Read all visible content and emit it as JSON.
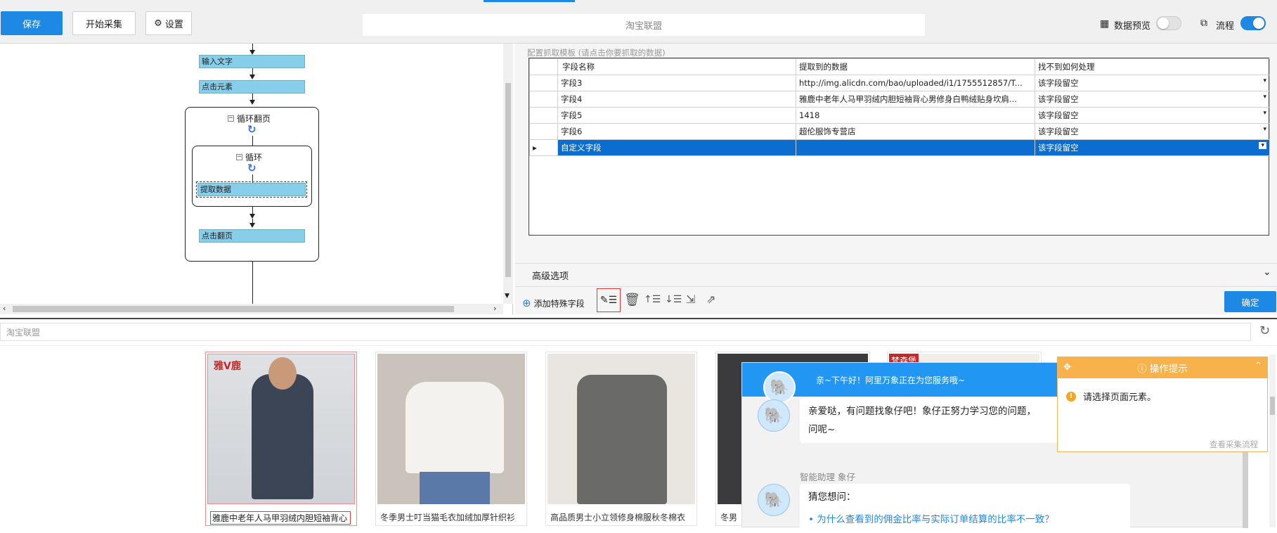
{
  "toolbar": {
    "save": "保存",
    "start": "开始采集",
    "settings": "设置",
    "url_title": "淘宝联盟",
    "data_preview": "数据预览",
    "flow": "流程"
  },
  "flow": {
    "nodes": {
      "input_text": "输入文字",
      "click_element": "点击元素",
      "loop_page": "循环翻页",
      "loop": "循环",
      "extract": "提取数据",
      "click_page": "点击翻页"
    }
  },
  "template": {
    "hint": "配置抓取模板 (请点击你要抓取的数据)",
    "headers": [
      "字段名称",
      "提取到的数据",
      "找不到如何处理"
    ],
    "rows": [
      {
        "name": "字段3",
        "value": "http://img.alicdn.com/bao/uploaded/i1/1755512857/T...",
        "handle": "该字段留空"
      },
      {
        "name": "字段4",
        "value": "雅鹿中老年人马甲羽绒内胆短袖背心男修身白鸭绒贴身坎肩...",
        "handle": "该字段留空"
      },
      {
        "name": "字段5",
        "value": "1418",
        "handle": "该字段留空"
      },
      {
        "name": "字段6",
        "value": "超伦服饰专营店",
        "handle": "该字段留空"
      },
      {
        "name": "自定义字段",
        "value": "",
        "handle": "该字段留空",
        "selected": true
      }
    ],
    "advanced": "高级选项",
    "add_special": "添加特殊字段",
    "confirm": "确定"
  },
  "browser": {
    "address": "淘宝联盟",
    "products": [
      {
        "title": "雅鹿中老年人马甲羽绒内胆短袖背心",
        "brand": "雅鹿",
        "highlighted": true
      },
      {
        "title": "冬季男士叮当猫毛衣加绒加厚针织衫"
      },
      {
        "title": "高品质男士小立领修身棉服秋冬棉衣"
      },
      {
        "title": "冬男"
      },
      {
        "title": "",
        "brand": "梵森堡"
      }
    ],
    "chat": {
      "header": "亲~下午好！阿里万象正在为您服务哦~",
      "msg1_line1": "亲爱哒，有问题找象仔吧！象仔正努力学习您的问题，",
      "msg1_line2": "问呢~",
      "assistant_name": "智能助理 象仔",
      "guess": "猜您想问：",
      "question1": "为什么查看到的佣金比率与实际订单结算的比率不一致？"
    },
    "tip": {
      "title": "操作提示",
      "message": "请选择页面元素。",
      "link": "查看采集流程"
    }
  }
}
